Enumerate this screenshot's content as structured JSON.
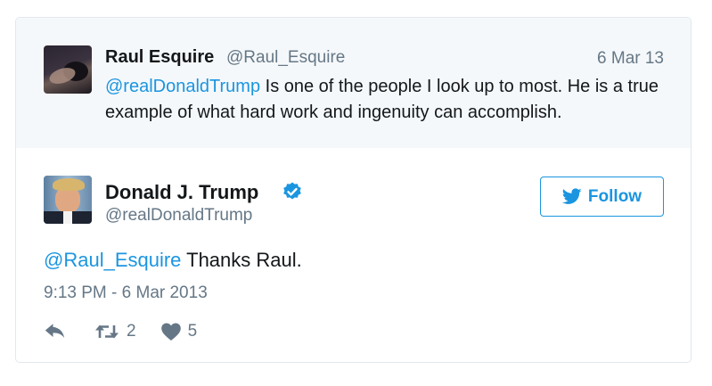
{
  "parent_tweet": {
    "author_name": "Raul Esquire",
    "author_handle": "@Raul_Esquire",
    "date": "6 Mar 13",
    "mention": "@realDonaldTrump",
    "text": " Is one of the people I look up to most. He is a true example of what hard work and ingenuity can accomplish."
  },
  "main_tweet": {
    "author_name": "Donald J. Trump",
    "author_handle": "@realDonaldTrump",
    "verified": true,
    "mention": "@Raul_Esquire",
    "text": " Thanks Raul.",
    "timestamp": "9:13 PM - 6 Mar 2013",
    "follow_label": "Follow",
    "retweet_count": "2",
    "like_count": "5"
  },
  "icons": {
    "verified": "verified-badge-icon",
    "follow": "twitter-bird-icon",
    "reply": "reply-icon",
    "retweet": "retweet-icon",
    "like": "heart-icon"
  },
  "colors": {
    "accent": "#1b95e0",
    "muted_text": "#657786",
    "text": "#14171a",
    "parent_background": "#f5f8fa",
    "border": "#e1e8ed"
  }
}
